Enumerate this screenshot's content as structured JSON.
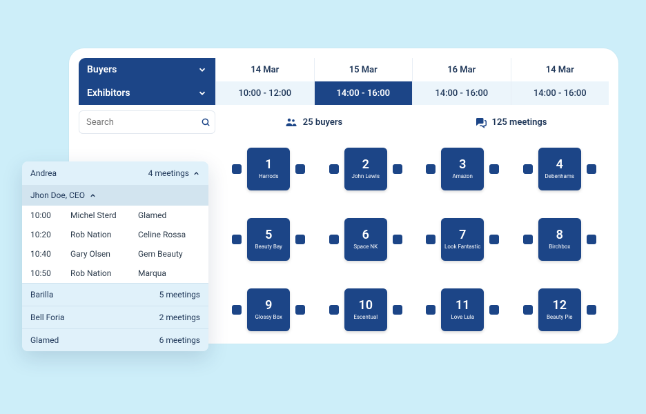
{
  "header": {
    "buyers_label": "Buyers",
    "exhibitors_label": "Exhibitors",
    "dates": [
      "14 Mar",
      "15 Mar",
      "16 Mar",
      "14 Mar"
    ],
    "times": [
      {
        "label": "10:00 - 12:00",
        "active": false
      },
      {
        "label": "14:00 - 16:00",
        "active": true
      },
      {
        "label": "14:00 - 16:00",
        "active": false
      },
      {
        "label": "14:00 - 16:00",
        "active": false
      }
    ]
  },
  "search": {
    "placeholder": "Search"
  },
  "stats": {
    "buyers": "25 buyers",
    "meetings": "125 meetings"
  },
  "tiles": [
    {
      "n": "1",
      "label": "Harrods"
    },
    {
      "n": "2",
      "label": "John Lewis"
    },
    {
      "n": "3",
      "label": "Amazon"
    },
    {
      "n": "4",
      "label": "Debenhams"
    },
    {
      "n": "5",
      "label": "Beauty Bay"
    },
    {
      "n": "6",
      "label": "Space NK"
    },
    {
      "n": "7",
      "label": "Look Fantastic"
    },
    {
      "n": "8",
      "label": "Birchbox"
    },
    {
      "n": "9",
      "label": "Glossy Box"
    },
    {
      "n": "10",
      "label": "Escentual"
    },
    {
      "n": "11",
      "label": "Love Lula"
    },
    {
      "n": "12",
      "label": "Beauty Pie"
    }
  ],
  "sidecard": {
    "name": "Andrea",
    "count": "4 meetings",
    "person": "Jhon Doe, CEO",
    "schedule": [
      {
        "time": "10:00",
        "person": "Michel Sterd",
        "company": "Glamed"
      },
      {
        "time": "10:20",
        "person": "Rob Nation",
        "company": "Celine Rossa"
      },
      {
        "time": "10:40",
        "person": "Gary Olsen",
        "company": "Gem Beauty"
      },
      {
        "time": "10:50",
        "person": "Rob Nation",
        "company": "Marqua"
      }
    ],
    "summary": [
      {
        "name": "Barilla",
        "count": "5 meetings"
      },
      {
        "name": "Bell Foria",
        "count": "2 meetings"
      },
      {
        "name": "Glamed",
        "count": "6 meetings"
      }
    ]
  }
}
